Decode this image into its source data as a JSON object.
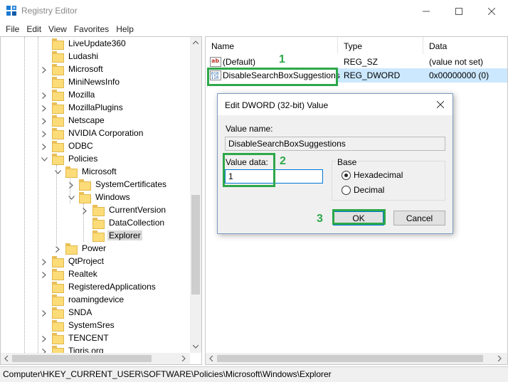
{
  "window": {
    "title": "Registry Editor",
    "icon": "registry-icon",
    "controls": [
      "minimize-icon",
      "maximize-icon",
      "close-icon"
    ]
  },
  "menu": [
    "File",
    "Edit",
    "View",
    "Favorites",
    "Help"
  ],
  "tree": {
    "items": [
      {
        "label": "LiveUpdate360",
        "depth": 0,
        "expander": "none"
      },
      {
        "label": "Ludashi",
        "depth": 0,
        "expander": "none"
      },
      {
        "label": "Microsoft",
        "depth": 0,
        "expander": "collapsed"
      },
      {
        "label": "MiniNewsInfo",
        "depth": 0,
        "expander": "none"
      },
      {
        "label": "Mozilla",
        "depth": 0,
        "expander": "collapsed"
      },
      {
        "label": "MozillaPlugins",
        "depth": 0,
        "expander": "collapsed"
      },
      {
        "label": "Netscape",
        "depth": 0,
        "expander": "collapsed"
      },
      {
        "label": "NVIDIA Corporation",
        "depth": 0,
        "expander": "collapsed"
      },
      {
        "label": "ODBC",
        "depth": 0,
        "expander": "collapsed"
      },
      {
        "label": "Policies",
        "depth": 0,
        "expander": "expanded"
      },
      {
        "label": "Microsoft",
        "depth": 1,
        "expander": "expanded"
      },
      {
        "label": "SystemCertificates",
        "depth": 2,
        "expander": "collapsed"
      },
      {
        "label": "Windows",
        "depth": 2,
        "expander": "expanded"
      },
      {
        "label": "CurrentVersion",
        "depth": 3,
        "expander": "collapsed"
      },
      {
        "label": "DataCollection",
        "depth": 3,
        "expander": "none"
      },
      {
        "label": "Explorer",
        "depth": 3,
        "expander": "none",
        "selected": true
      },
      {
        "label": "Power",
        "depth": 1,
        "expander": "collapsed"
      },
      {
        "label": "QtProject",
        "depth": 0,
        "expander": "collapsed"
      },
      {
        "label": "Realtek",
        "depth": 0,
        "expander": "collapsed"
      },
      {
        "label": "RegisteredApplications",
        "depth": 0,
        "expander": "none"
      },
      {
        "label": "roamingdevice",
        "depth": 0,
        "expander": "none"
      },
      {
        "label": "SNDA",
        "depth": 0,
        "expander": "collapsed"
      },
      {
        "label": "SystemSres",
        "depth": 0,
        "expander": "none"
      },
      {
        "label": "TENCENT",
        "depth": 0,
        "expander": "collapsed"
      },
      {
        "label": "Tigris.org",
        "depth": 0,
        "expander": "collapsed"
      }
    ]
  },
  "values_list": {
    "columns": [
      "Name",
      "Type",
      "Data"
    ],
    "rows": [
      {
        "name": "(Default)",
        "type": "REG_SZ",
        "data": "(value not set)",
        "icon": "string-value-icon"
      },
      {
        "name": "DisableSearchBoxSuggestions",
        "type": "REG_DWORD",
        "data": "0x00000000 (0)",
        "icon": "binary-value-icon",
        "selected": true
      }
    ]
  },
  "dialog": {
    "title": "Edit DWORD (32-bit) Value",
    "value_name_label": "Value name:",
    "value_name": "DisableSearchBoxSuggestions",
    "value_data_label": "Value data:",
    "value_data": "1",
    "base_label": "Base",
    "base_options": [
      {
        "label": "Hexadecimal",
        "checked": true
      },
      {
        "label": "Decimal",
        "checked": false
      }
    ],
    "ok_label": "OK",
    "cancel_label": "Cancel"
  },
  "annotations": {
    "step1": "1",
    "step2": "2",
    "step3": "3"
  },
  "status_path": "Computer\\HKEY_CURRENT_USER\\SOFTWARE\\Policies\\Microsoft\\Windows\\Explorer",
  "colors": {
    "annotation": "#2ea84a",
    "selection": "#cce8ff",
    "folder": "#fcdc79",
    "accent": "#0078d7"
  }
}
